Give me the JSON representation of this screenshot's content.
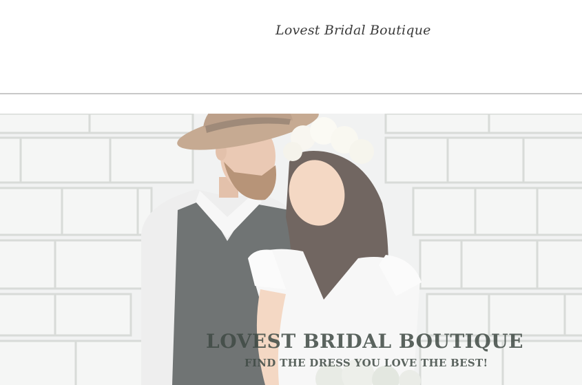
{
  "header": {
    "site_name": "Lovest Bridal Boutique"
  },
  "hero": {
    "image": "couple-photo",
    "title": "LOVEST BRIDAL BOUTIQUE",
    "subtitle": "FIND THE DRESS YOU LOVE THE BEST!"
  },
  "colors": {
    "header_bg": "#ffffff",
    "rule": "#c8c8c8",
    "brick_wall": "#eef0ef",
    "hero_text": "#3f4a44"
  }
}
